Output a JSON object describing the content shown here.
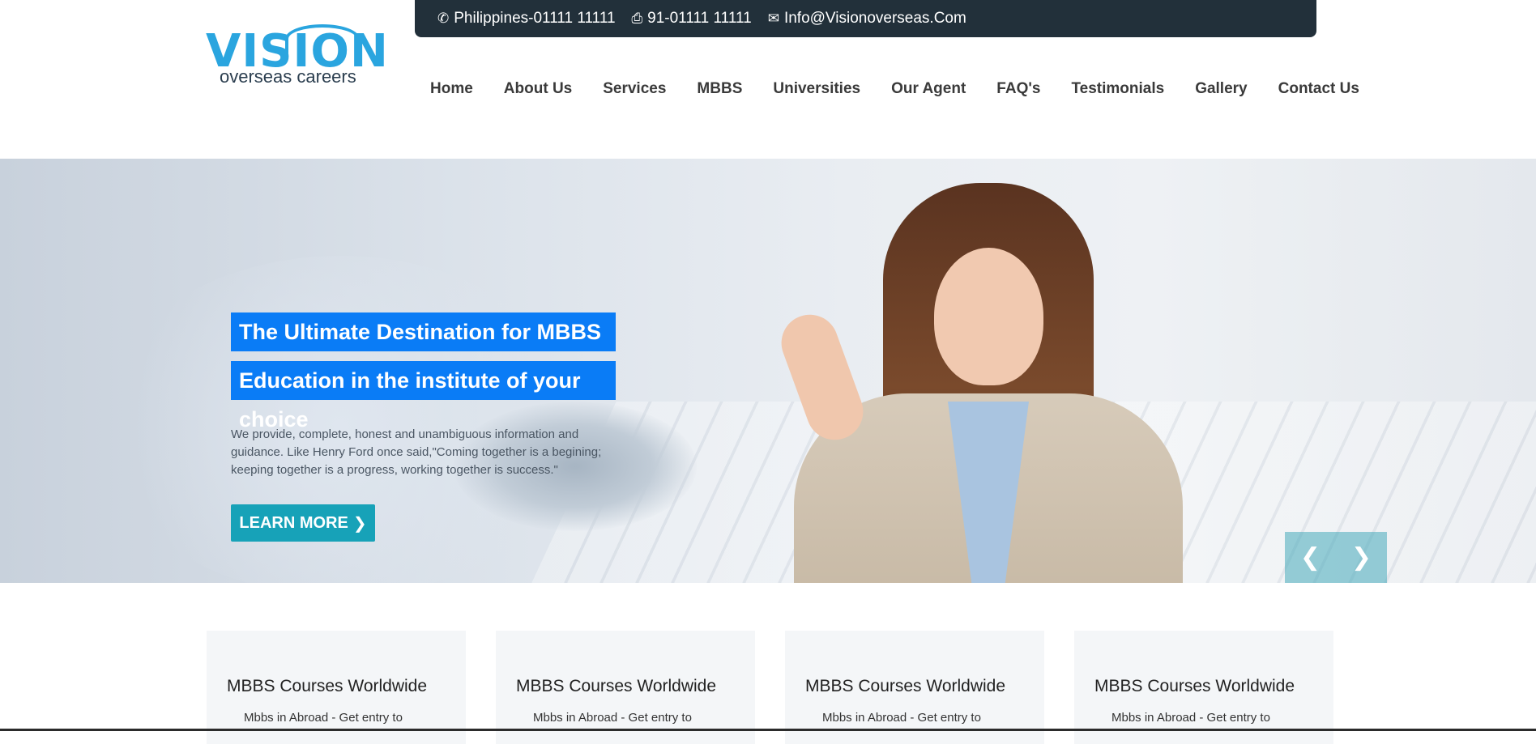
{
  "brand": {
    "logo_word": "VISION",
    "logo_tagline": "overseas careers"
  },
  "topbar": {
    "phone": "Philippines-01111 11111",
    "fax": "91-01111 11111",
    "email": "Info@Visionoverseas.Com",
    "phone_icon": "phone-icon",
    "fax_icon": "print-icon",
    "email_icon": "envelope-icon",
    "bg_color": "#22303a"
  },
  "nav": {
    "items": [
      {
        "label": "Home"
      },
      {
        "label": "About Us"
      },
      {
        "label": "Services"
      },
      {
        "label": "MBBS"
      },
      {
        "label": "Universities"
      },
      {
        "label": "Our Agent"
      },
      {
        "label": "FAQ's"
      },
      {
        "label": "Testimonials"
      },
      {
        "label": "Gallery"
      },
      {
        "label": "Contact Us"
      }
    ]
  },
  "hero": {
    "title_line1": "The Ultimate Destination for MBBS",
    "title_line2": "Education in the institute of your choice",
    "description": "We provide, complete, honest and unambiguous information and guidance. Like Henry Ford once said,\"Coming together is a begining; keeping together is a progress, working together is success.\"",
    "button_label": "LEARN MORE",
    "button_color": "#17a2b8",
    "title_bg_color": "#0a7cf6",
    "prev_icon": "chevron-left-icon",
    "next_icon": "chevron-right-icon"
  },
  "cards": [
    {
      "title": "MBBS Courses Worldwide",
      "text": "Mbbs in Abroad - Get entry to"
    },
    {
      "title": "MBBS Courses Worldwide",
      "text": "Mbbs in Abroad - Get entry to"
    },
    {
      "title": "MBBS Courses Worldwide",
      "text": "Mbbs in Abroad - Get entry to"
    },
    {
      "title": "MBBS Courses Worldwide",
      "text": "Mbbs in Abroad - Get entry to"
    }
  ]
}
